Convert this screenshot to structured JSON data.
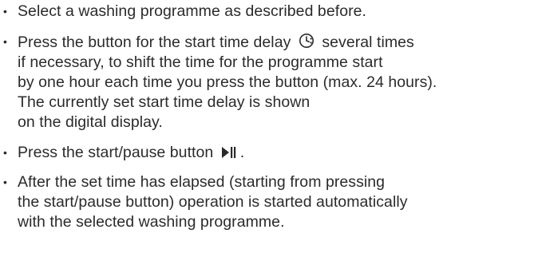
{
  "bullet_char": "•",
  "items": [
    {
      "parts": [
        "Select a washing programme as described before."
      ]
    },
    {
      "line1_before_icon": "Press the button for the start time delay",
      "line1_icon": "clock-icon",
      "line1_after_icon": "several times",
      "lines": [
        "if necessary, to shift the time for the programme start",
        "by one hour each time you press the button (max. 24 hours).",
        "The currently set start time delay is shown",
        "on the digital display."
      ]
    },
    {
      "before_icon": "Press the start/pause button",
      "icon": "play-pause-icon",
      "after_icon": "."
    },
    {
      "lines": [
        "After the set time has elapsed (starting from pressing",
        "the start/pause button) operation is started automatically",
        "with the selected washing programme."
      ]
    }
  ]
}
